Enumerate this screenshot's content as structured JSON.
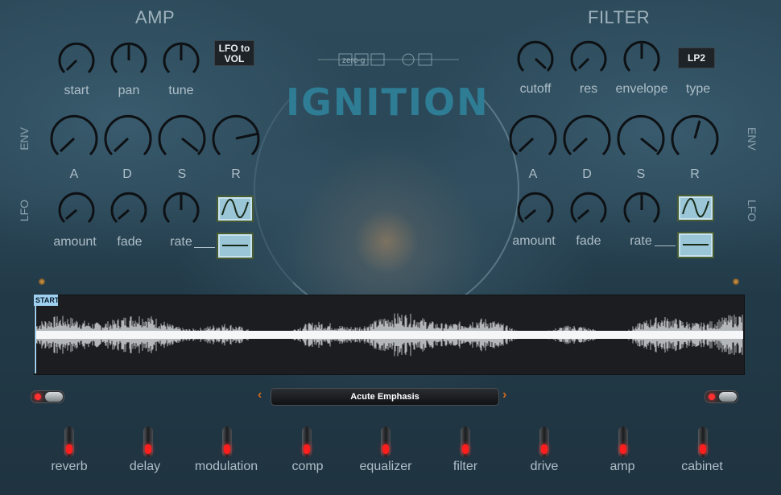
{
  "amp": {
    "title": "AMP",
    "lfo_to_vol": "LFO to\nVOL",
    "row1": [
      "start",
      "pan",
      "tune"
    ],
    "env": [
      "A",
      "D",
      "S",
      "R"
    ],
    "lfo": [
      "amount",
      "fade",
      "rate"
    ],
    "side_env": "ENV",
    "side_lfo": "LFO"
  },
  "filter": {
    "title": "FILTER",
    "type_value": "LP2",
    "row1": [
      "cutoff",
      "res",
      "envelope",
      "type"
    ],
    "env": [
      "A",
      "D",
      "S",
      "R"
    ],
    "lfo": [
      "amount",
      "fade",
      "rate"
    ],
    "side_env": "ENV",
    "side_lfo": "LFO"
  },
  "logo": {
    "brand": "zero-g",
    "product": "IGNITION"
  },
  "sample": {
    "start_marker": "START"
  },
  "preset": {
    "name": "Acute Emphasis",
    "prev": "‹",
    "next": "›"
  },
  "effects": [
    "reverb",
    "delay",
    "modulation",
    "comp",
    "equalizer",
    "filter",
    "drive",
    "amp",
    "cabinet"
  ],
  "colors": {
    "accent": "#d26a1c",
    "led": "#ff1e1e",
    "lfo_button": "#9ac6d8",
    "logo": "#2f7d95"
  }
}
